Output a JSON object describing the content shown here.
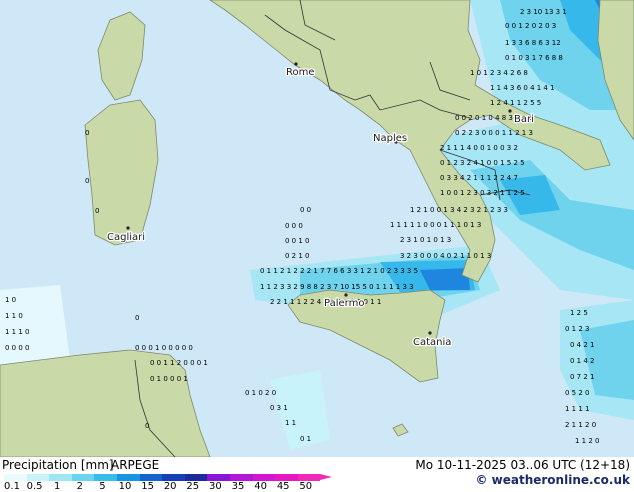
{
  "map": {
    "cities": [
      {
        "name": "Rome"
      },
      {
        "name": "Bari"
      },
      {
        "name": "Naples"
      },
      {
        "name": "Cagliari"
      },
      {
        "name": "Palermo"
      },
      {
        "name": "Catania"
      }
    ],
    "colors": {
      "sea": "#cfe8f7",
      "land": "#c9d9a8",
      "border": "#333333",
      "label": "#000000"
    }
  },
  "legend": {
    "title": "Precipitation [mm]",
    "model": "ARPEGE",
    "tick_labels": [
      "0.1",
      "0.5",
      "1",
      "2",
      "5",
      "10",
      "15",
      "20",
      "25",
      "30",
      "35",
      "40",
      "45",
      "50"
    ],
    "colors": [
      "#e9fbff",
      "#c9f3fb",
      "#9fe6f5",
      "#6ad5ee",
      "#36bdea",
      "#1696e2",
      "#1464cf",
      "#1640b8",
      "#1c2a9c",
      "#8a17d6",
      "#b317d8",
      "#d217d2",
      "#e817c4",
      "#f02ab8"
    ]
  },
  "valid_time": "Mo 10-11-2025 03..06 UTC (12+18)",
  "watermark": "© weatheronline.co.uk"
}
